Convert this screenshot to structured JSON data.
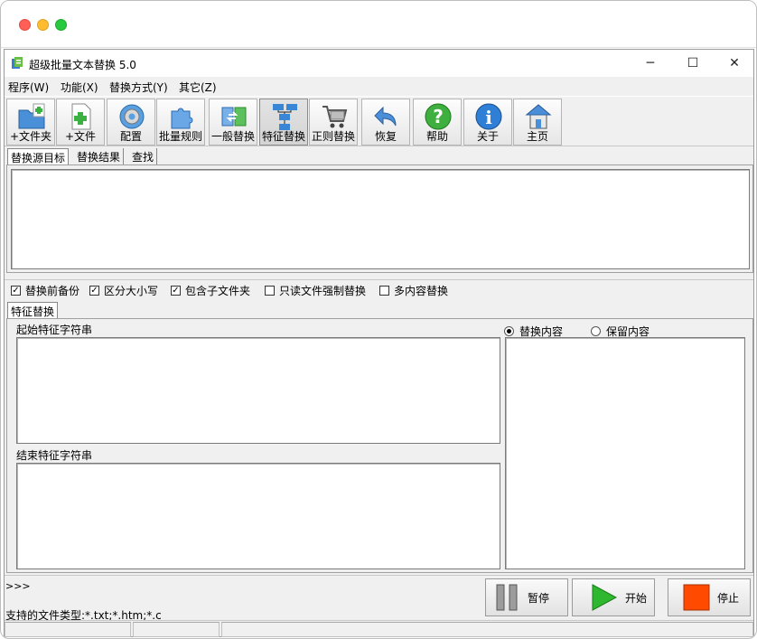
{
  "window": {
    "title": "超级批量文本替换 5.0",
    "controls": {
      "minimize": "─",
      "maximize": "☐",
      "close": "✕"
    }
  },
  "menu": [
    {
      "label": "程序(W)"
    },
    {
      "label": "功能(X)"
    },
    {
      "label": "替换方式(Y)"
    },
    {
      "label": "其它(Z)"
    }
  ],
  "toolbar": [
    {
      "label": "+文件夹",
      "icon": "add-folder-icon"
    },
    {
      "label": "+文件",
      "icon": "add-file-icon"
    },
    {
      "label": "配置",
      "icon": "settings-icon"
    },
    {
      "label": "批量规则",
      "icon": "puzzle-icon"
    },
    {
      "label": "一般替换",
      "icon": "swap-icon"
    },
    {
      "label": "特征替换",
      "icon": "hierarchy-icon",
      "active": true
    },
    {
      "label": "正则替换",
      "icon": "cart-icon"
    },
    {
      "label": "恢复",
      "icon": "undo-icon"
    },
    {
      "label": "帮助",
      "icon": "help-icon"
    },
    {
      "label": "关于",
      "icon": "info-icon"
    },
    {
      "label": "主页",
      "icon": "home-icon"
    }
  ],
  "source_tabs": [
    {
      "label": "替换源目标",
      "selected": true
    },
    {
      "label": "替换结果"
    },
    {
      "label": "查找"
    }
  ],
  "options": [
    {
      "label": "替换前备份",
      "checked": true
    },
    {
      "label": "区分大小写",
      "checked": true
    },
    {
      "label": "包含子文件夹",
      "checked": true
    },
    {
      "label": "只读文件强制替换",
      "checked": false
    },
    {
      "label": "多内容替换",
      "checked": false
    }
  ],
  "feature_tab": {
    "label": "特征替换"
  },
  "feature": {
    "start_label": "起始特征字符串",
    "end_label": "结束特征字符串",
    "radio_replace": "替换内容",
    "radio_keep": "保留内容",
    "replace_selected": true
  },
  "bottom": {
    "prompt": ">>>",
    "file_types": "支持的文件类型:*.txt;*.htm;*.c",
    "pause_label": "暂停",
    "start_label": "开始",
    "stop_label": "停止"
  },
  "colors": {
    "start_green": "#2fb82f",
    "stop_orange": "#ff4a00"
  }
}
